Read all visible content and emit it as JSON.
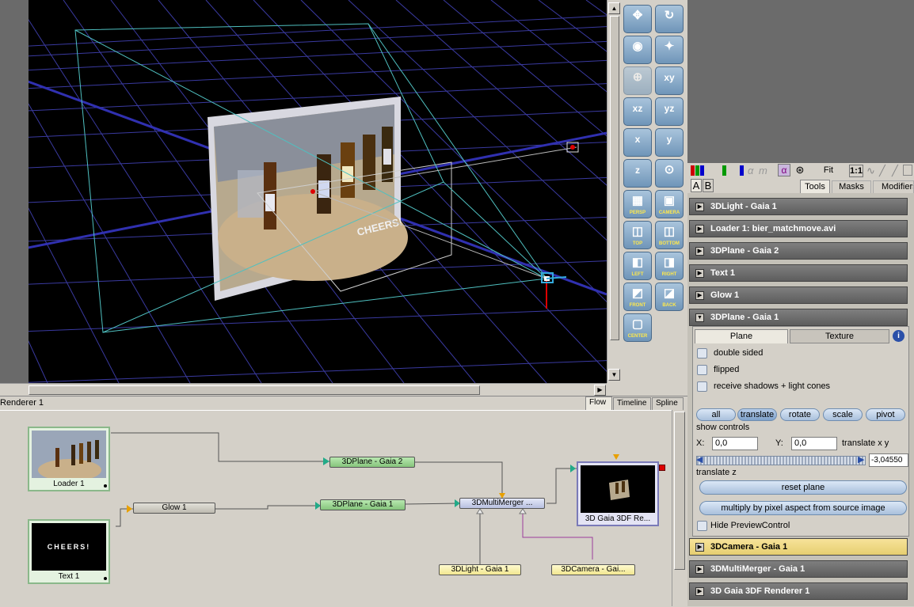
{
  "viewport": {
    "title": "Renderer 1",
    "overlay_text": "CHEERS!"
  },
  "view_tabs": [
    {
      "label": "Flow",
      "active": true
    },
    {
      "label": "Timeline",
      "active": false
    },
    {
      "label": "Spline",
      "active": false
    }
  ],
  "toolbar": {
    "transform_buttons": [
      "move",
      "rotate",
      "orbit",
      "select",
      "zoom",
      "xy",
      "xz",
      "yz",
      "x",
      "y",
      "z",
      "scale"
    ],
    "axis_labels": {
      "xy": "xy",
      "xz": "xz",
      "yz": "yz",
      "x": "x",
      "y": "y",
      "z": "z"
    },
    "view_buttons": [
      "PERSP",
      "CAMERA",
      "TOP",
      "BOTTOM",
      "LEFT",
      "RIGHT",
      "FRONT",
      "BACK",
      "CENTER"
    ]
  },
  "flow": {
    "nodes": {
      "loader": "Loader 1",
      "text": "Text 1",
      "glow": "Glow 1",
      "plane2": "3DPlane - Gaia 2",
      "plane1": "3DPlane - Gaia 1",
      "merger": "3DMultiMerger ...",
      "light": "3DLight - Gaia 1",
      "camera": "3DCamera - Gai...",
      "renderer": "3D Gaia 3DF Re..."
    },
    "text_preview": "CHEERS!"
  },
  "right_panel": {
    "fit_label": "Fit",
    "ratio_label": "1:1",
    "channel_colors": [
      "#cc0000",
      "#009900",
      "#0000cc"
    ],
    "ab": [
      "A",
      "B"
    ],
    "tabs": [
      "Tools",
      "Masks",
      "Modifiers"
    ],
    "tools": [
      "3DLight - Gaia 1",
      "Loader 1: bier_matchmove.avi",
      "3DPlane - Gaia 2",
      "Text 1",
      "Glow 1",
      "3DPlane - Gaia 1"
    ],
    "plane": {
      "tabs": [
        "Plane",
        "Texture"
      ],
      "checkboxes": [
        "double sided",
        "flipped",
        "receive shadows + light cones"
      ],
      "control_buttons": [
        "all",
        "translate",
        "rotate",
        "scale",
        "pivot"
      ],
      "active_control": "translate",
      "show_controls": "show controls",
      "x_label": "X:",
      "x_value": "0,0",
      "y_label": "Y:",
      "y_value": "0,0",
      "translate_xy": "translate x y",
      "z_value": "-3,04550",
      "translate_z": "translate z",
      "reset": "reset plane",
      "multiply": "multiply by pixel aspect from source image",
      "hide_preview": "Hide PreviewControl"
    },
    "bottom_tools": [
      "3DCamera - Gaia 1",
      "3DMultiMerger - Gaia 1",
      "3D Gaia 3DF Renderer 1"
    ]
  }
}
